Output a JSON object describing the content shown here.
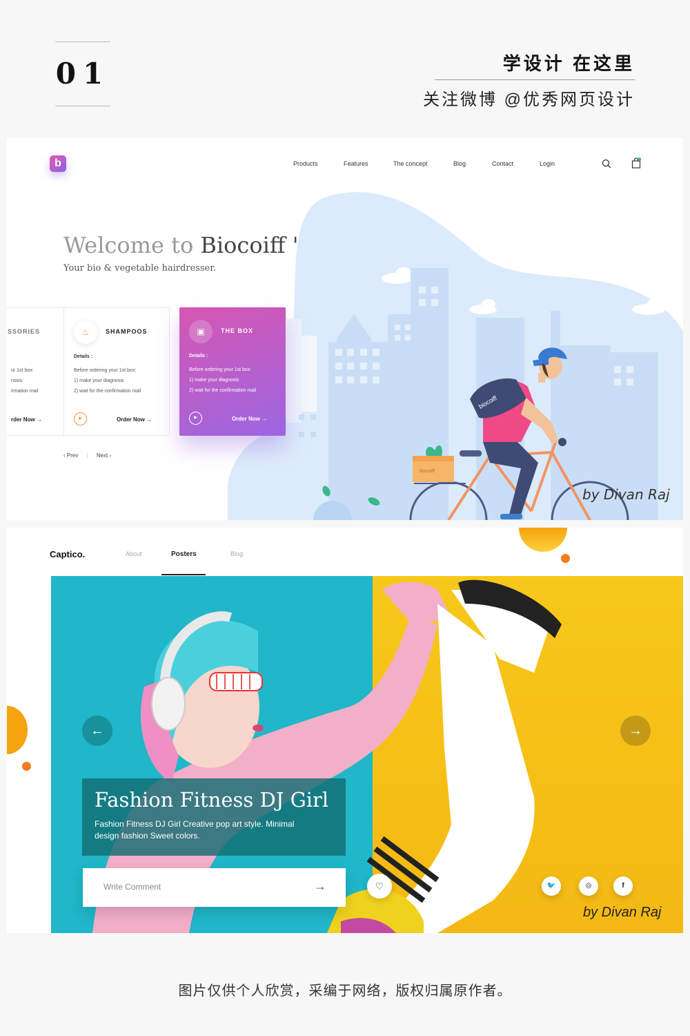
{
  "header": {
    "number": "01",
    "tagline_main": "学设计 在这里",
    "tagline_sub": "关注微博 @优秀网页设计"
  },
  "biocoiff": {
    "logo_letter": "b",
    "nav": [
      "Products",
      "Features",
      "The concept",
      "Blog",
      "Contact",
      "Login"
    ],
    "cart_count": "0",
    "title_light": "Welcome to ",
    "title_dark": "Biocoiff '",
    "subtitle": "Your bio & vegetable hairdresser.",
    "cards": [
      {
        "title": "SSORIES",
        "details": "Details :",
        "lines": [
          "ur 1st box:",
          "nosis",
          "irmation mail"
        ],
        "order": "rder Now →"
      },
      {
        "title": "SHAMPOOS",
        "details": "Details :",
        "lines": [
          "Before ordering your 1st box:",
          "1) make your diagnosis",
          "2) wait for the confirmation mail"
        ],
        "order": "Order Now →"
      },
      {
        "title": "THE BOX",
        "details": "Details :",
        "lines": [
          "Before ordering your 1st box:",
          "1) make your diagnosis",
          "2) wait for the confirmation mail"
        ],
        "order": "Order Now →"
      }
    ],
    "pager_prev": "‹  Prev",
    "pager_sep": "|",
    "pager_next": "Next  ›",
    "bag_label": "biocoiff",
    "box_label": "biocoiff",
    "credit": "by Divan Raj",
    "colors": {
      "accent_pink": "#d756b2",
      "accent_purple": "#9b66e2",
      "sky": "#dcebfb"
    }
  },
  "captico": {
    "logo": "Captico.",
    "nav": [
      "About",
      "Posters",
      "Blog"
    ],
    "active_nav": "Posters",
    "caption_title": "Fashion Fitness DJ Girl",
    "caption_text": "Fashion Fitness DJ Girl Creative pop art style. Minimal design fashion Sweet colors.",
    "comment_placeholder": "Write Comment",
    "social": [
      "twitter-icon",
      "instagram-icon",
      "facebook-icon"
    ],
    "social_glyphs": [
      "🐦",
      "◎",
      "f"
    ],
    "credit": "by Divan Raj",
    "colors": {
      "cyan": "#1fb7c9",
      "yellow": "#f7c81a",
      "orange": "#f5a30f"
    }
  },
  "footer": {
    "text": "图片仅供个人欣赏，采编于网络，版权归属原作者。"
  }
}
